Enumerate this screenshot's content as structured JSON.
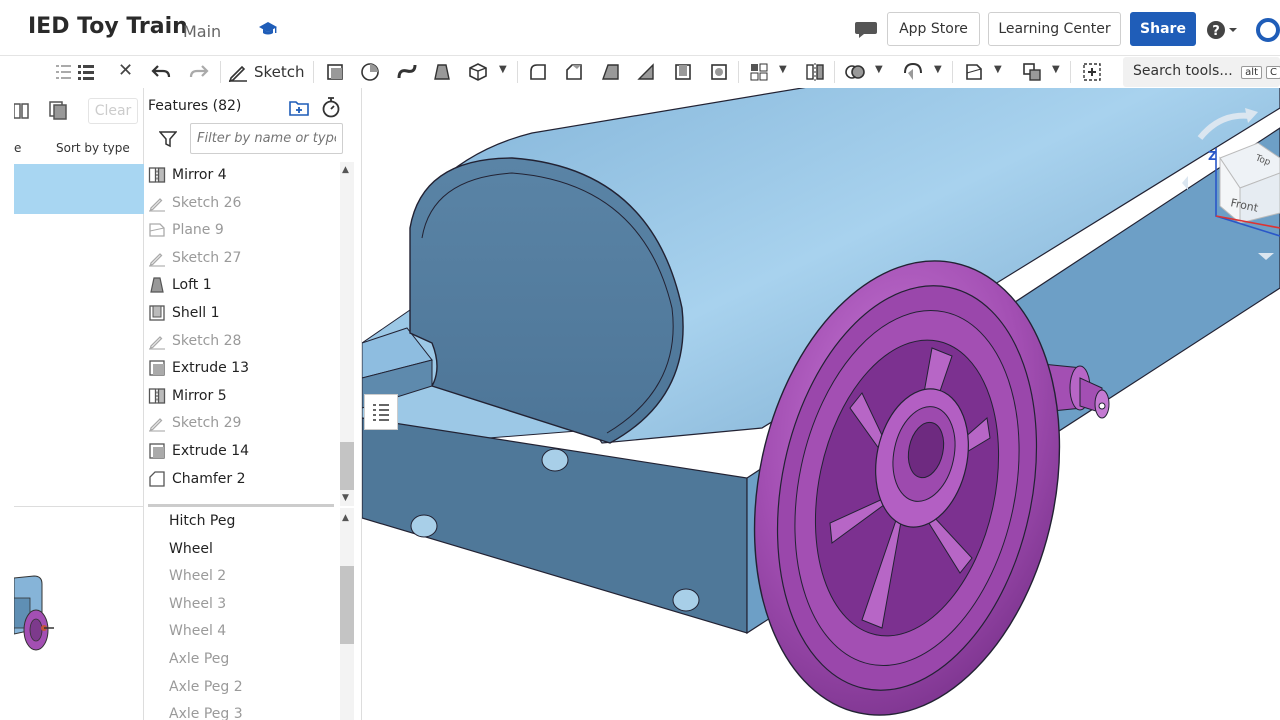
{
  "header": {
    "title": "IED Toy Train",
    "branch": "Main",
    "app_store": "App Store",
    "learning_center": "Learning Center",
    "share": "Share"
  },
  "toolbar": {
    "sketch": "Sketch",
    "search_tools": "Search tools...",
    "kbd_alt": "alt",
    "kbd_c": "C"
  },
  "left_panel": {
    "clear": "Clear",
    "column_fragment": "e",
    "sort_by": "Sort by type"
  },
  "features": {
    "title": "Features (82)",
    "filter_placeholder": "Filter by name or type",
    "items": [
      {
        "label": "Mirror 4",
        "icon": "mirror-icon",
        "suppressed": false
      },
      {
        "label": "Sketch 26",
        "icon": "sketch-icon",
        "suppressed": true
      },
      {
        "label": "Plane 9",
        "icon": "plane-icon",
        "suppressed": true
      },
      {
        "label": "Sketch 27",
        "icon": "sketch-icon",
        "suppressed": true
      },
      {
        "label": "Loft 1",
        "icon": "loft-icon",
        "suppressed": false
      },
      {
        "label": "Shell 1",
        "icon": "shell-icon",
        "suppressed": false
      },
      {
        "label": "Sketch 28",
        "icon": "sketch-icon",
        "suppressed": true
      },
      {
        "label": "Extrude 13",
        "icon": "extrude-icon",
        "suppressed": false
      },
      {
        "label": "Mirror 5",
        "icon": "mirror-icon",
        "suppressed": false
      },
      {
        "label": "Sketch 29",
        "icon": "sketch-icon",
        "suppressed": true
      },
      {
        "label": "Extrude 14",
        "icon": "extrude-icon",
        "suppressed": false
      },
      {
        "label": "Chamfer 2",
        "icon": "chamfer-icon",
        "suppressed": false
      }
    ]
  },
  "parts": {
    "items": [
      {
        "label": "Hitch Peg",
        "hidden": false
      },
      {
        "label": "Wheel",
        "hidden": false
      },
      {
        "label": "Wheel 2",
        "hidden": true
      },
      {
        "label": "Wheel 3",
        "hidden": true
      },
      {
        "label": "Wheel 4",
        "hidden": true
      },
      {
        "label": "Axle Peg",
        "hidden": true
      },
      {
        "label": "Axle Peg 2",
        "hidden": true
      },
      {
        "label": "Axle Peg 3",
        "hidden": true
      }
    ]
  },
  "view_cube": {
    "front": "Front",
    "top": "Top",
    "axis_z": "Z"
  },
  "colors": {
    "accent": "#1f5db8",
    "body": "#86b4d8",
    "wheel": "#a34fb3",
    "selection": "#a8d6f2"
  }
}
